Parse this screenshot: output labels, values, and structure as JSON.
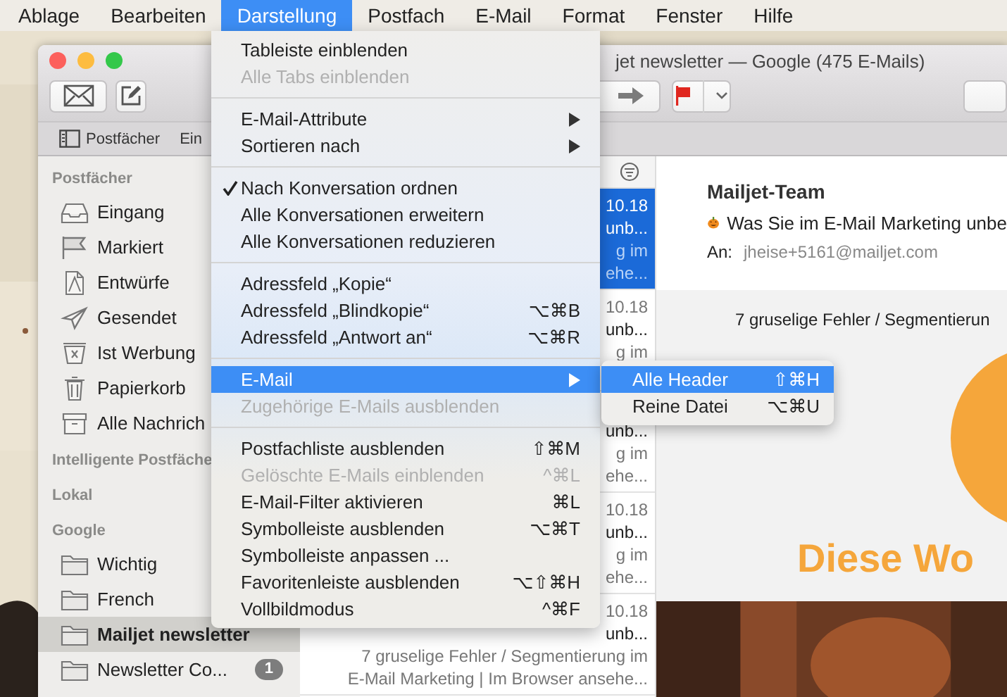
{
  "menu_bar": [
    {
      "label": "Ablage",
      "selected": false
    },
    {
      "label": "Bearbeiten",
      "selected": false
    },
    {
      "label": "Darstellung",
      "selected": true
    },
    {
      "label": "Postfach",
      "selected": false
    },
    {
      "label": "E-Mail",
      "selected": false
    },
    {
      "label": "Format",
      "selected": false
    },
    {
      "label": "Fenster",
      "selected": false
    },
    {
      "label": "Hilfe",
      "selected": false
    }
  ],
  "window": {
    "title": "jet newsletter — Google (475 E-Mails)"
  },
  "favorites_bar": [
    {
      "label": "Postfächer"
    },
    {
      "label": "Ein"
    }
  ],
  "sidebar": {
    "sections": [
      {
        "title": "Postfächer",
        "items": [
          {
            "label": "Eingang",
            "kind": "inbox",
            "selected": false
          },
          {
            "label": "Markiert",
            "kind": "flag",
            "selected": false
          },
          {
            "label": "Entwürfe",
            "kind": "draft",
            "selected": false
          },
          {
            "label": "Gesendet",
            "kind": "sent",
            "selected": false
          },
          {
            "label": "Ist Werbung",
            "kind": "junk",
            "selected": false
          },
          {
            "label": "Papierkorb",
            "kind": "trash",
            "selected": false
          },
          {
            "label": "Alle Nachrich",
            "kind": "archive",
            "selected": false
          }
        ]
      },
      {
        "title": "Intelligente Postfäche"
      },
      {
        "title": "Lokal"
      },
      {
        "title": "Google",
        "items": [
          {
            "label": "Wichtig",
            "kind": "folder",
            "selected": false
          },
          {
            "label": "French",
            "kind": "folder",
            "selected": false
          },
          {
            "label": "Mailjet newsletter",
            "kind": "folder",
            "selected": true
          },
          {
            "label": "Newsletter Co...",
            "kind": "folder",
            "selected": false,
            "badge": "1"
          }
        ]
      }
    ]
  },
  "message_list": {
    "rows": [
      {
        "selected": true,
        "date": "10.18",
        "lines": [
          "unb...",
          "g im",
          "ehe..."
        ]
      },
      {
        "selected": false,
        "date": "10.18",
        "lines": [
          "unb...",
          "g im"
        ]
      },
      {
        "selected": false,
        "lines": [
          "unb...",
          "g im",
          "ehe..."
        ]
      },
      {
        "selected": false,
        "date": "10.18",
        "lines": [
          "unb...",
          "g im",
          "ehe..."
        ]
      },
      {
        "selected": false,
        "date": "10.18",
        "lines": [
          "unb...",
          "7 gruselige Fehler / Segmentierung im",
          "E-Mail Marketing | Im Browser ansehe..."
        ]
      }
    ]
  },
  "preview": {
    "sender": "Mailjet-Team",
    "subject": "Was Sie im E-Mail Marketing unbe",
    "to_label": "An:",
    "to": "jheise+5161@mailjet.com",
    "body_line": "7 gruselige Fehler / Segmentierun",
    "heading": "Diese Wo"
  },
  "menu": [
    {
      "kind": "item",
      "label": "Tableiste einblenden",
      "disabled": false
    },
    {
      "kind": "item",
      "label": "Alle Tabs einblenden",
      "disabled": true
    },
    {
      "kind": "separator"
    },
    {
      "kind": "item",
      "label": "E-Mail-Attribute",
      "disabled": false,
      "submenu": true
    },
    {
      "kind": "item",
      "label": "Sortieren nach",
      "disabled": false,
      "submenu": true
    },
    {
      "kind": "separator"
    },
    {
      "kind": "item",
      "label": "Nach Konversation ordnen",
      "disabled": false,
      "checked": true
    },
    {
      "kind": "item",
      "label": "Alle Konversationen erweitern",
      "disabled": false
    },
    {
      "kind": "item",
      "label": "Alle Konversationen reduzieren",
      "disabled": false
    },
    {
      "kind": "separator"
    },
    {
      "kind": "item",
      "label": "Adressfeld „Kopie“",
      "disabled": false
    },
    {
      "kind": "item",
      "label": "Adressfeld „Blindkopie“",
      "disabled": false,
      "shortcut": "⌥⌘B"
    },
    {
      "kind": "item",
      "label": "Adressfeld „Antwort an“",
      "disabled": false,
      "shortcut": "⌥⌘R"
    },
    {
      "kind": "separator"
    },
    {
      "kind": "item",
      "label": "E-Mail",
      "disabled": false,
      "submenu": true,
      "selected": true
    },
    {
      "kind": "item",
      "label": "Zugehörige E-Mails ausblenden",
      "disabled": true
    },
    {
      "kind": "separator"
    },
    {
      "kind": "item",
      "label": "Postfachliste ausblenden",
      "disabled": false,
      "shortcut": "⇧⌘M"
    },
    {
      "kind": "item",
      "label": "Gelöschte E-Mails einblenden",
      "disabled": true,
      "shortcut": "^⌘L"
    },
    {
      "kind": "item",
      "label": "E-Mail-Filter aktivieren",
      "disabled": false,
      "shortcut": "⌘L"
    },
    {
      "kind": "item",
      "label": "Symbolleiste ausblenden",
      "disabled": false,
      "shortcut": "⌥⌘T"
    },
    {
      "kind": "item",
      "label": "Symbolleiste anpassen ...",
      "disabled": false
    },
    {
      "kind": "item",
      "label": "Favoritenleiste ausblenden",
      "disabled": false,
      "shortcut": "⌥⇧⌘H"
    },
    {
      "kind": "item",
      "label": "Vollbildmodus",
      "disabled": false,
      "shortcut": "^⌘F"
    }
  ],
  "submenu": [
    {
      "label": "Alle Header",
      "shortcut": "⇧⌘H",
      "selected": true
    },
    {
      "label": "Reine Datei",
      "shortcut": "⌥⌘U",
      "selected": false
    }
  ]
}
